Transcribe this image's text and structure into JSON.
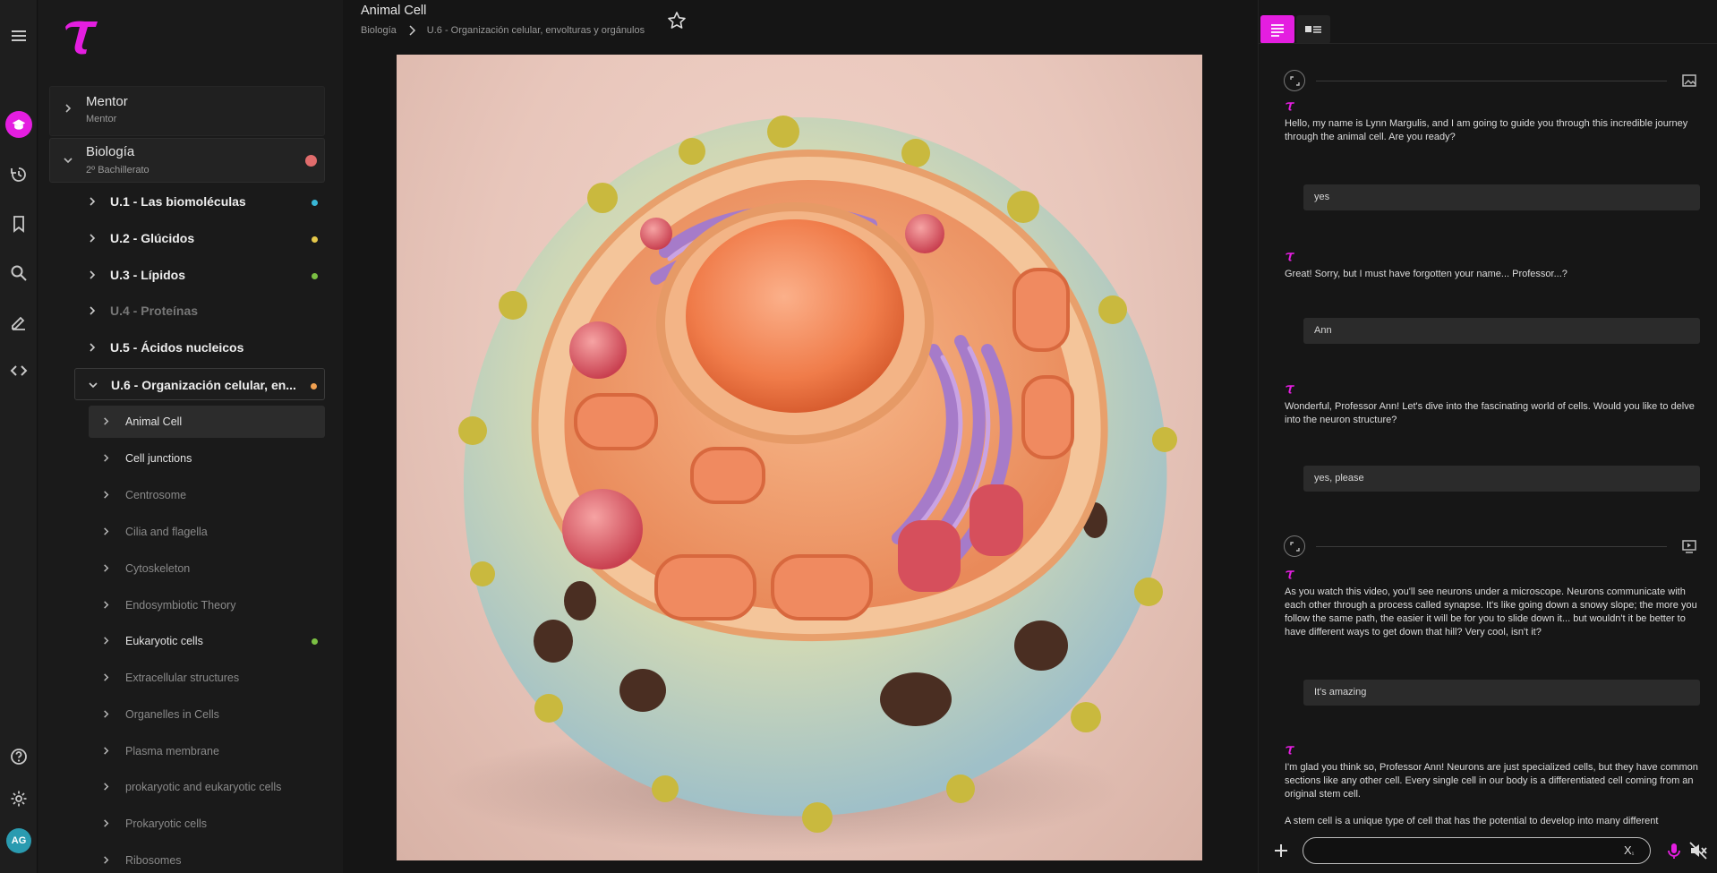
{
  "rail": {
    "avatar_initials": "AG"
  },
  "sidebar": {
    "mentor": {
      "title": "Mentor",
      "subtitle": "Mentor"
    },
    "course": {
      "title": "Biología",
      "subtitle": "2º Bachillerato",
      "dot_color": "#e06c6c"
    },
    "units": [
      {
        "label": "U.1 - Las biomoléculas",
        "dot_color": "#39b7d6",
        "dim": false
      },
      {
        "label": "U.2 - Glúcidos",
        "dot_color": "#e5c84a",
        "dim": false
      },
      {
        "label": "U.3 - Lípidos",
        "dot_color": "#7bc043",
        "dim": false
      },
      {
        "label": "U.4 - Proteínas",
        "dot_color": "",
        "dim": true
      },
      {
        "label": "U.5 - Ácidos nucleicos",
        "dot_color": "",
        "dim": false
      },
      {
        "label": "U.6 - Organización celular, en...",
        "dot_color": "#f0a050",
        "dim": false
      }
    ],
    "lessons": [
      {
        "label": "Animal Cell",
        "bright": true,
        "active": true,
        "dot_color": ""
      },
      {
        "label": "Cell junctions",
        "bright": true,
        "active": false,
        "dot_color": ""
      },
      {
        "label": "Centrosome",
        "bright": false,
        "active": false,
        "dot_color": ""
      },
      {
        "label": "Cilia and flagella",
        "bright": false,
        "active": false,
        "dot_color": ""
      },
      {
        "label": "Cytoskeleton",
        "bright": false,
        "active": false,
        "dot_color": ""
      },
      {
        "label": "Endosymbiotic Theory",
        "bright": false,
        "active": false,
        "dot_color": ""
      },
      {
        "label": "Eukaryotic cells",
        "bright": true,
        "active": false,
        "dot_color": "#7bc043"
      },
      {
        "label": "Extracellular structures",
        "bright": false,
        "active": false,
        "dot_color": ""
      },
      {
        "label": "Organelles in Cells",
        "bright": false,
        "active": false,
        "dot_color": ""
      },
      {
        "label": "Plasma membrane",
        "bright": false,
        "active": false,
        "dot_color": ""
      },
      {
        "label": "prokaryotic and eukaryotic cells",
        "bright": false,
        "active": false,
        "dot_color": ""
      },
      {
        "label": "Prokaryotic cells",
        "bright": false,
        "active": false,
        "dot_color": ""
      },
      {
        "label": "Ribosomes",
        "bright": false,
        "active": false,
        "dot_color": ""
      }
    ]
  },
  "main": {
    "title": "Animal Cell",
    "breadcrumb": [
      "Biología",
      "U.6 - Organización celular, envolturas y orgánulos"
    ]
  },
  "chat": {
    "accent": "#e41ee0",
    "messages": [
      {
        "role": "bot",
        "text": "Hello, my name is Lynn Margulis, and I am going to guide you through this incredible journey through the animal cell. Are you ready?"
      },
      {
        "role": "user",
        "text": "yes"
      },
      {
        "role": "bot",
        "text": "Great! Sorry, but I must have forgotten your name... Professor...?"
      },
      {
        "role": "user",
        "text": "Ann"
      },
      {
        "role": "bot",
        "text": "Wonderful, Professor Ann! Let's dive into the fascinating world of cells. Would you like to delve into the neuron structure?"
      },
      {
        "role": "user",
        "text": "yes, please"
      },
      {
        "role": "bot",
        "text": "As you watch this video, you'll see neurons under a microscope. Neurons communicate with each other through a process called synapse. It's like going down a snowy slope; the more you follow the same path, the easier it will be for you to slide down it... but wouldn't it be better to have different ways to get down that hill? Very cool, isn't it?"
      },
      {
        "role": "user",
        "text": "It's amazing"
      },
      {
        "role": "bot",
        "text": "I'm glad you think so, Professor Ann! Neurons are just specialized cells, but they have common sections like any other cell. Every single cell in our body is a differentiated cell coming from an original stem cell."
      },
      {
        "role": "bot",
        "text": "A stem cell is a unique type of cell that has the potential to develop into many different"
      }
    ],
    "composer": {
      "placeholder": "",
      "subscript_label": "X",
      "subscript_small": "₁"
    }
  }
}
